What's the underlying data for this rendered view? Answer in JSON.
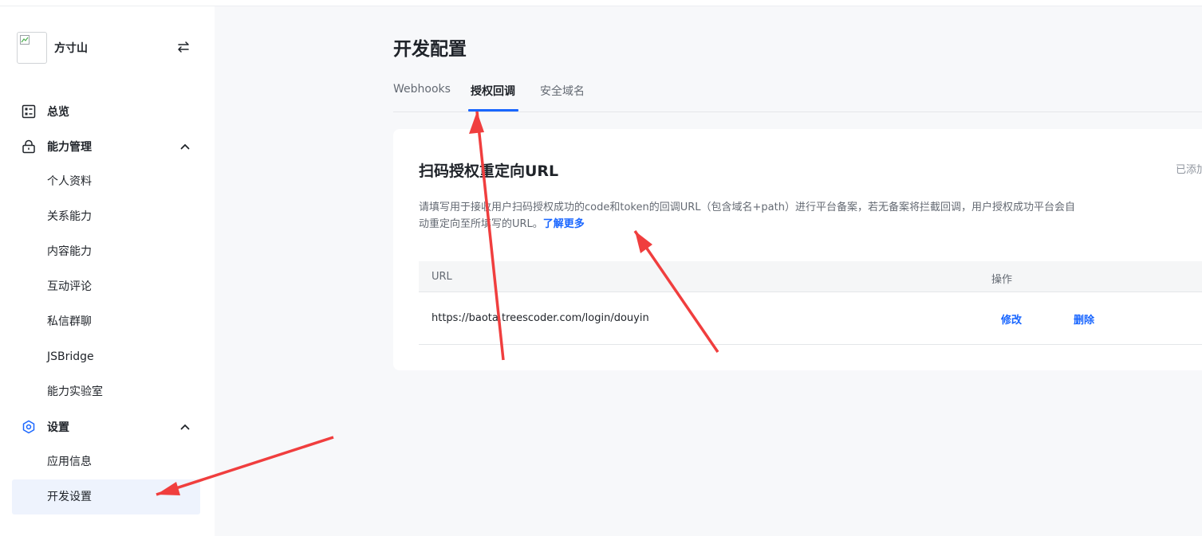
{
  "app": {
    "name": "方寸山",
    "logo_icon": "broken-image-icon",
    "switch_icon": "switch-arrows-icon"
  },
  "sidebar": {
    "groups": [
      {
        "label": "总览",
        "icon": "dashboard-icon",
        "expanded": null,
        "items": []
      },
      {
        "label": "能力管理",
        "icon": "lock-icon",
        "expanded": true,
        "items": [
          "个人资料",
          "关系能力",
          "内容能力",
          "互动评论",
          "私信群聊",
          "JSBridge",
          "能力实验室"
        ]
      },
      {
        "label": "设置",
        "icon": "hexagon-settings-icon",
        "expanded": true,
        "items": [
          "应用信息",
          "开发设置"
        ]
      }
    ],
    "active_item": "开发设置"
  },
  "main": {
    "title": "开发配置",
    "tabs": [
      {
        "label": "Webhooks",
        "active": false
      },
      {
        "label": "授权回调",
        "active": true
      },
      {
        "label": "安全域名",
        "active": false
      }
    ],
    "card": {
      "title": "扫码授权重定向URL",
      "right_text": "已添加",
      "description": "请填写用于接收用户扫码授权成功的code和token的回调URL（包含域名+path）进行平台备案，若无备案将拦截回调，用户授权成功平台会自动重定向至所填写的URL。",
      "learn_more": "了解更多",
      "table": {
        "columns": [
          "URL",
          "操作"
        ],
        "rows": [
          {
            "url": "https://baota.treescoder.com/login/douyin",
            "edit": "修改",
            "delete": "删除"
          }
        ]
      }
    }
  },
  "colors": {
    "accent": "#1966ff",
    "active_bg": "#eef3fd",
    "annotation_arrow": "#f03e3e",
    "page_bg": "#f7f8fa"
  }
}
